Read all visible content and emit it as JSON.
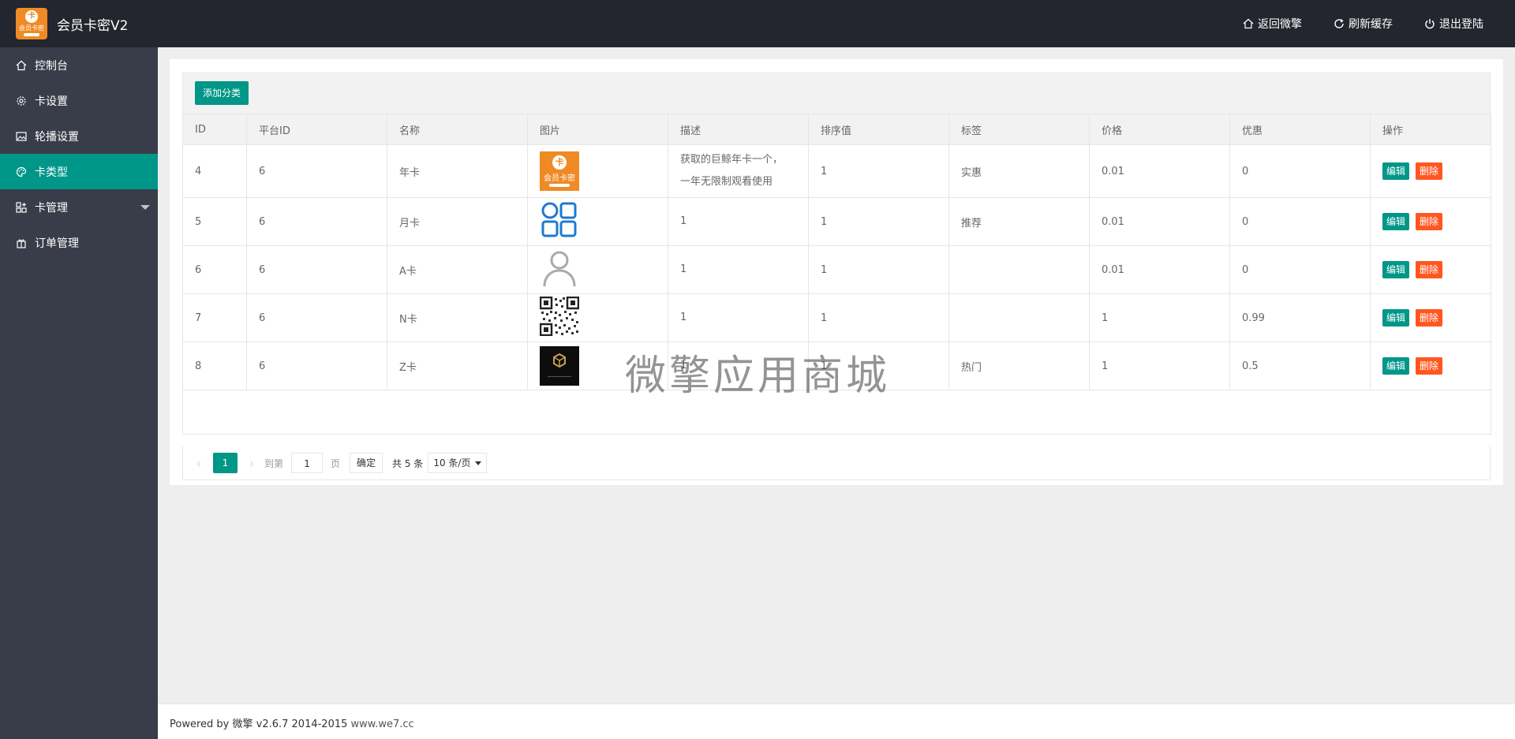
{
  "app": {
    "title": "会员卡密V2",
    "logo_text": "会员卡密",
    "logo_glyph": "卡"
  },
  "header": {
    "links": [
      {
        "label": "返回微擎",
        "icon": "home-icon"
      },
      {
        "label": "刷新缓存",
        "icon": "refresh-icon"
      },
      {
        "label": "退出登陆",
        "icon": "power-icon"
      }
    ]
  },
  "sidebar": {
    "items": [
      {
        "label": "控制台",
        "icon": "home-icon"
      },
      {
        "label": "卡设置",
        "icon": "gear-icon"
      },
      {
        "label": "轮播设置",
        "icon": "image-icon"
      },
      {
        "label": "卡类型",
        "icon": "palette-icon",
        "active": true
      },
      {
        "label": "卡管理",
        "icon": "apps-add-icon",
        "has_submenu": true
      },
      {
        "label": "订单管理",
        "icon": "gift-icon"
      }
    ]
  },
  "toolbar": {
    "add_label": "添加分类"
  },
  "table": {
    "headers": [
      "ID",
      "平台ID",
      "名称",
      "图片",
      "描述",
      "排序值",
      "标签",
      "价格",
      "优惠",
      "操作"
    ],
    "edit_label": "编辑",
    "delete_label": "删除",
    "rows": [
      {
        "id": "4",
        "platform_id": "6",
        "name": "年卡",
        "image": "orange-logo",
        "desc_line1": "获取的巨鲸年卡一个，",
        "desc_line2": "一年无限制观看使用",
        "sort": "1",
        "tag": "实惠",
        "price": "0.01",
        "discount": "0"
      },
      {
        "id": "5",
        "platform_id": "6",
        "name": "月卡",
        "image": "grid-icon",
        "desc_line1": "1",
        "desc_line2": "",
        "sort": "1",
        "tag": "推荐",
        "price": "0.01",
        "discount": "0"
      },
      {
        "id": "6",
        "platform_id": "6",
        "name": "A卡",
        "image": "user-icon",
        "desc_line1": "1",
        "desc_line2": "",
        "sort": "1",
        "tag": "",
        "price": "0.01",
        "discount": "0"
      },
      {
        "id": "7",
        "platform_id": "6",
        "name": "N卡",
        "image": "qr-code",
        "desc_line1": "1",
        "desc_line2": "",
        "sort": "1",
        "tag": "",
        "price": "1",
        "discount": "0.99"
      },
      {
        "id": "8",
        "platform_id": "6",
        "name": "Z卡",
        "image": "black-logo",
        "desc_line1": "1",
        "desc_line2": "",
        "sort": "1",
        "tag": "热门",
        "price": "1",
        "discount": "0.5"
      }
    ]
  },
  "pager": {
    "prev": "‹",
    "next": "›",
    "current": "1",
    "goto_label": "到第",
    "goto_value": "1",
    "page_unit": "页",
    "confirm": "确定",
    "total": "共 5 条",
    "per_page": "10 条/页"
  },
  "watermark": "微擎应用商城",
  "footer": {
    "powered": "Powered by ",
    "brand": "微擎",
    "version": " v2.6.7 2014-2015 ",
    "site": "www.we7.cc"
  },
  "colors": {
    "accent": "#009688",
    "danger": "#ff5722",
    "header_bg": "#23262e",
    "sidebar_bg": "#393d49"
  }
}
